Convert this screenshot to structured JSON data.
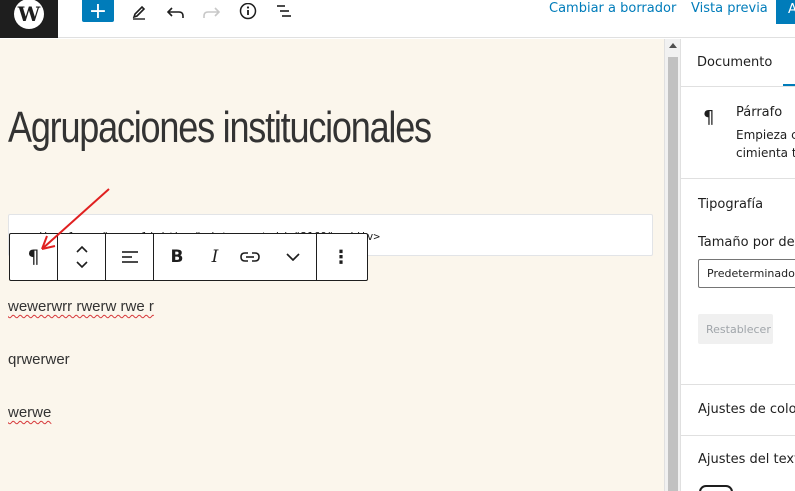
{
  "topbar": {
    "logo_letter": "W",
    "add_symbol": "+",
    "switch_to_draft": "Cambiar a borrador",
    "preview": "Vista previa",
    "publish_partial": "A",
    "icons": [
      "wordpress-logo",
      "plus-icon",
      "pencil-icon",
      "undo-icon",
      "redo-icon",
      "info-icon",
      "list-view-icon"
    ]
  },
  "editor": {
    "title": "Agrupaciones institucionales",
    "html_code": "<div class=\"meow-lightbox\" data-post-id=\"2169\"></div>",
    "paragraphs": [
      "wewerwrr rwerw rwe r",
      "qrwerwer",
      "werwe"
    ]
  },
  "block_toolbar": {
    "paragraph_symbol": "¶",
    "bold": "B",
    "italic": "I",
    "more": "⋮",
    "icons": [
      "paragraph-icon",
      "move-up-down-icon",
      "align-icon",
      "bold-icon",
      "italic-icon",
      "link-icon",
      "chevron-down-icon",
      "more-options-icon"
    ]
  },
  "sidebar": {
    "tab_document": "Documento",
    "block_icon": "¶",
    "block_name": "Párrafo",
    "block_desc_line1": "Empieza c",
    "block_desc_line2": "cimienta to",
    "typography": "Tipografía",
    "font_size_label": "Tamaño por defe",
    "font_size_value": "Predeterminado",
    "reset": "Restablecer",
    "color_settings": "Ajustes de color",
    "text_settings": "Ajustes del texto"
  },
  "colors": {
    "accent": "#007cba",
    "canvas_bg": "#fbf6ec",
    "annotation_arrow": "#e02020"
  }
}
